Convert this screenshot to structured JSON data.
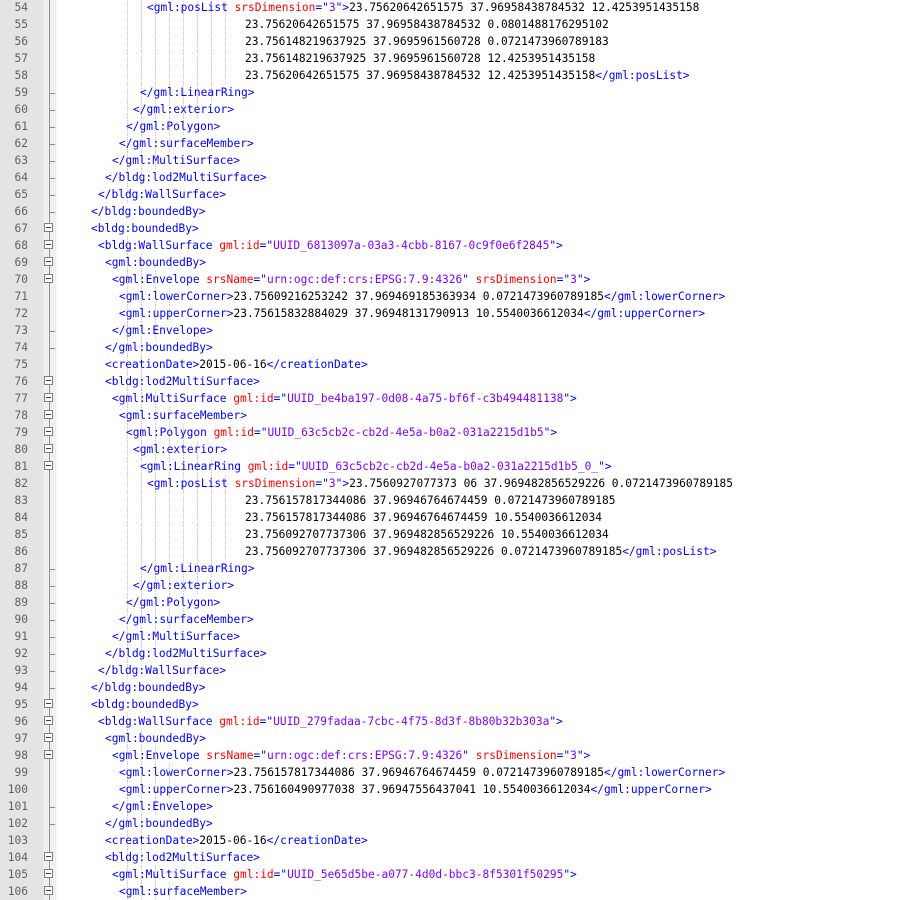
{
  "editor": {
    "lines": [
      {
        "n": "54",
        "indent": 13,
        "fold": "none",
        "segs": [
          [
            "t",
            "<gml:posList "
          ],
          [
            "a",
            "srsDimension"
          ],
          [
            "t",
            "=\""
          ],
          [
            "v",
            "3"
          ],
          [
            "t",
            "\">"
          ],
          [
            "x",
            "23.75620642651575 37.96958438784532 12.4253951435158"
          ]
        ]
      },
      {
        "n": "55",
        "indent": 27,
        "fold": "none",
        "segs": [
          [
            "x",
            "23.75620642651575 37.96958438784532 0.0801488176295102"
          ]
        ]
      },
      {
        "n": "56",
        "indent": 27,
        "fold": "none",
        "segs": [
          [
            "x",
            "23.756148219637925 37.9695961560728 0.0721473960789183"
          ]
        ]
      },
      {
        "n": "57",
        "indent": 27,
        "fold": "none",
        "segs": [
          [
            "x",
            "23.756148219637925 37.9695961560728 12.4253951435158"
          ]
        ]
      },
      {
        "n": "58",
        "indent": 27,
        "fold": "none",
        "segs": [
          [
            "x",
            "23.75620642651575 37.96958438784532 12.4253951435158"
          ],
          [
            "t",
            "</gml:posList>"
          ]
        ]
      },
      {
        "n": "59",
        "indent": 12,
        "fold": "end",
        "segs": [
          [
            "t",
            "</gml:LinearRing>"
          ]
        ]
      },
      {
        "n": "60",
        "indent": 11,
        "fold": "end",
        "segs": [
          [
            "t",
            "</gml:exterior>"
          ]
        ]
      },
      {
        "n": "61",
        "indent": 10,
        "fold": "end",
        "segs": [
          [
            "t",
            "</gml:Polygon>"
          ]
        ]
      },
      {
        "n": "62",
        "indent": 9,
        "fold": "end",
        "segs": [
          [
            "t",
            "</gml:surfaceMember>"
          ]
        ]
      },
      {
        "n": "63",
        "indent": 8,
        "fold": "end",
        "segs": [
          [
            "t",
            "</gml:MultiSurface>"
          ]
        ]
      },
      {
        "n": "64",
        "indent": 7,
        "fold": "end",
        "segs": [
          [
            "t",
            "</bldg:lod2MultiSurface>"
          ]
        ]
      },
      {
        "n": "65",
        "indent": 6,
        "fold": "end",
        "segs": [
          [
            "t",
            "</bldg:WallSurface>"
          ]
        ]
      },
      {
        "n": "66",
        "indent": 5,
        "fold": "end",
        "segs": [
          [
            "t",
            "</bldg:boundedBy>"
          ]
        ]
      },
      {
        "n": "67",
        "indent": 5,
        "fold": "open",
        "segs": [
          [
            "t",
            "<bldg:boundedBy>"
          ]
        ]
      },
      {
        "n": "68",
        "indent": 6,
        "fold": "open",
        "segs": [
          [
            "t",
            "<bldg:WallSurface "
          ],
          [
            "a",
            "gml:id"
          ],
          [
            "t",
            "=\""
          ],
          [
            "v",
            "UUID_6813097a-03a3-4cbb-8167-0c9f0e6f2845"
          ],
          [
            "t",
            "\">"
          ]
        ]
      },
      {
        "n": "69",
        "indent": 7,
        "fold": "open",
        "segs": [
          [
            "t",
            "<gml:boundedBy>"
          ]
        ]
      },
      {
        "n": "70",
        "indent": 8,
        "fold": "open",
        "segs": [
          [
            "t",
            "<gml:Envelope "
          ],
          [
            "a",
            "srsName"
          ],
          [
            "t",
            "=\""
          ],
          [
            "v",
            "urn:ogc:def:crs:EPSG:7.9:4326"
          ],
          [
            "t",
            "\" "
          ],
          [
            "a",
            "srsDimension"
          ],
          [
            "t",
            "=\""
          ],
          [
            "v",
            "3"
          ],
          [
            "t",
            "\">"
          ]
        ]
      },
      {
        "n": "71",
        "indent": 9,
        "fold": "none",
        "segs": [
          [
            "t",
            "<gml:lowerCorner>"
          ],
          [
            "x",
            "23.75609216253242 37.969469185363934 0.0721473960789185"
          ],
          [
            "t",
            "</gml:lowerCorner>"
          ]
        ]
      },
      {
        "n": "72",
        "indent": 9,
        "fold": "none",
        "segs": [
          [
            "t",
            "<gml:upperCorner>"
          ],
          [
            "x",
            "23.75615832884029 37.96948131790913 10.5540036612034"
          ],
          [
            "t",
            "</gml:upperCorner>"
          ]
        ]
      },
      {
        "n": "73",
        "indent": 8,
        "fold": "end",
        "segs": [
          [
            "t",
            "</gml:Envelope>"
          ]
        ]
      },
      {
        "n": "74",
        "indent": 7,
        "fold": "end",
        "segs": [
          [
            "t",
            "</gml:boundedBy>"
          ]
        ]
      },
      {
        "n": "75",
        "indent": 7,
        "fold": "none",
        "segs": [
          [
            "t",
            "<creationDate>"
          ],
          [
            "x",
            "2015-06-16"
          ],
          [
            "t",
            "</creationDate>"
          ]
        ]
      },
      {
        "n": "76",
        "indent": 7,
        "fold": "open",
        "segs": [
          [
            "t",
            "<bldg:lod2MultiSurface>"
          ]
        ]
      },
      {
        "n": "77",
        "indent": 8,
        "fold": "open",
        "segs": [
          [
            "t",
            "<gml:MultiSurface "
          ],
          [
            "a",
            "gml:id"
          ],
          [
            "t",
            "=\""
          ],
          [
            "v",
            "UUID_be4ba197-0d08-4a75-bf6f-c3b494481138"
          ],
          [
            "t",
            "\">"
          ]
        ]
      },
      {
        "n": "78",
        "indent": 9,
        "fold": "open",
        "segs": [
          [
            "t",
            "<gml:surfaceMember>"
          ]
        ]
      },
      {
        "n": "79",
        "indent": 10,
        "fold": "open",
        "segs": [
          [
            "t",
            "<gml:Polygon "
          ],
          [
            "a",
            "gml:id"
          ],
          [
            "t",
            "=\""
          ],
          [
            "v",
            "UUID_63c5cb2c-cb2d-4e5a-b0a2-031a2215d1b5"
          ],
          [
            "t",
            "\">"
          ]
        ]
      },
      {
        "n": "80",
        "indent": 11,
        "fold": "open",
        "segs": [
          [
            "t",
            "<gml:exterior>"
          ]
        ]
      },
      {
        "n": "81",
        "indent": 12,
        "fold": "open",
        "segs": [
          [
            "t",
            "<gml:LinearRing "
          ],
          [
            "a",
            "gml:id"
          ],
          [
            "t",
            "=\""
          ],
          [
            "v",
            "UUID_63c5cb2c-cb2d-4e5a-b0a2-031a2215d1b5_0_"
          ],
          [
            "t",
            "\">"
          ]
        ]
      },
      {
        "n": "82",
        "indent": 13,
        "fold": "none",
        "segs": [
          [
            "t",
            "<gml:posList "
          ],
          [
            "a",
            "srsDimension"
          ],
          [
            "t",
            "=\""
          ],
          [
            "v",
            "3"
          ],
          [
            "t",
            "\">"
          ],
          [
            "x",
            "23.7560927077373 06 37.969482856529226 0.0721473960789185"
          ]
        ]
      },
      {
        "n": "83",
        "indent": 27,
        "fold": "none",
        "segs": [
          [
            "x",
            "23.756157817344086 37.96946764674459 0.0721473960789185"
          ]
        ]
      },
      {
        "n": "84",
        "indent": 27,
        "fold": "none",
        "segs": [
          [
            "x",
            "23.756157817344086 37.96946764674459 10.5540036612034"
          ]
        ]
      },
      {
        "n": "85",
        "indent": 27,
        "fold": "none",
        "segs": [
          [
            "x",
            "23.756092707737306 37.969482856529226 10.5540036612034"
          ]
        ]
      },
      {
        "n": "86",
        "indent": 27,
        "fold": "none",
        "segs": [
          [
            "x",
            "23.756092707737306 37.969482856529226 0.0721473960789185"
          ],
          [
            "t",
            "</gml:posList>"
          ]
        ]
      },
      {
        "n": "87",
        "indent": 12,
        "fold": "end",
        "segs": [
          [
            "t",
            "</gml:LinearRing>"
          ]
        ]
      },
      {
        "n": "88",
        "indent": 11,
        "fold": "end",
        "segs": [
          [
            "t",
            "</gml:exterior>"
          ]
        ]
      },
      {
        "n": "89",
        "indent": 10,
        "fold": "end",
        "segs": [
          [
            "t",
            "</gml:Polygon>"
          ]
        ]
      },
      {
        "n": "90",
        "indent": 9,
        "fold": "end",
        "segs": [
          [
            "t",
            "</gml:surfaceMember>"
          ]
        ]
      },
      {
        "n": "91",
        "indent": 8,
        "fold": "end",
        "segs": [
          [
            "t",
            "</gml:MultiSurface>"
          ]
        ]
      },
      {
        "n": "92",
        "indent": 7,
        "fold": "end",
        "segs": [
          [
            "t",
            "</bldg:lod2MultiSurface>"
          ]
        ]
      },
      {
        "n": "93",
        "indent": 6,
        "fold": "end",
        "segs": [
          [
            "t",
            "</bldg:WallSurface>"
          ]
        ]
      },
      {
        "n": "94",
        "indent": 5,
        "fold": "end",
        "segs": [
          [
            "t",
            "</bldg:boundedBy>"
          ]
        ]
      },
      {
        "n": "95",
        "indent": 5,
        "fold": "open",
        "segs": [
          [
            "t",
            "<bldg:boundedBy>"
          ]
        ]
      },
      {
        "n": "96",
        "indent": 6,
        "fold": "open",
        "segs": [
          [
            "t",
            "<bldg:WallSurface "
          ],
          [
            "a",
            "gml:id"
          ],
          [
            "t",
            "=\""
          ],
          [
            "v",
            "UUID_279fadaa-7cbc-4f75-8d3f-8b80b32b303a"
          ],
          [
            "t",
            "\">"
          ]
        ]
      },
      {
        "n": "97",
        "indent": 7,
        "fold": "open",
        "segs": [
          [
            "t",
            "<gml:boundedBy>"
          ]
        ]
      },
      {
        "n": "98",
        "indent": 8,
        "fold": "open",
        "segs": [
          [
            "t",
            "<gml:Envelope "
          ],
          [
            "a",
            "srsName"
          ],
          [
            "t",
            "=\""
          ],
          [
            "v",
            "urn:ogc:def:crs:EPSG:7.9:4326"
          ],
          [
            "t",
            "\" "
          ],
          [
            "a",
            "srsDimension"
          ],
          [
            "t",
            "=\""
          ],
          [
            "v",
            "3"
          ],
          [
            "t",
            "\">"
          ]
        ]
      },
      {
        "n": "99",
        "indent": 9,
        "fold": "none",
        "segs": [
          [
            "t",
            "<gml:lowerCorner>"
          ],
          [
            "x",
            "23.756157817344086 37.96946764674459 0.0721473960789185"
          ],
          [
            "t",
            "</gml:lowerCorner>"
          ]
        ]
      },
      {
        "n": "100",
        "indent": 9,
        "fold": "none",
        "segs": [
          [
            "t",
            "<gml:upperCorner>"
          ],
          [
            "x",
            "23.756160490977038 37.96947556437041 10.5540036612034"
          ],
          [
            "t",
            "</gml:upperCorner>"
          ]
        ]
      },
      {
        "n": "101",
        "indent": 8,
        "fold": "end",
        "segs": [
          [
            "t",
            "</gml:Envelope>"
          ]
        ]
      },
      {
        "n": "102",
        "indent": 7,
        "fold": "end",
        "segs": [
          [
            "t",
            "</gml:boundedBy>"
          ]
        ]
      },
      {
        "n": "103",
        "indent": 7,
        "fold": "none",
        "segs": [
          [
            "t",
            "<creationDate>"
          ],
          [
            "x",
            "2015-06-16"
          ],
          [
            "t",
            "</creationDate>"
          ]
        ]
      },
      {
        "n": "104",
        "indent": 7,
        "fold": "open",
        "segs": [
          [
            "t",
            "<bldg:lod2MultiSurface>"
          ]
        ]
      },
      {
        "n": "105",
        "indent": 8,
        "fold": "open",
        "segs": [
          [
            "t",
            "<gml:MultiSurface "
          ],
          [
            "a",
            "gml:id"
          ],
          [
            "t",
            "=\""
          ],
          [
            "v",
            "UUID_5e65d5be-a077-4d0d-bbc3-8f5301f50295"
          ],
          [
            "t",
            "\">"
          ]
        ]
      },
      {
        "n": "106",
        "indent": 9,
        "fold": "open",
        "segs": [
          [
            "t",
            "<gml:surfaceMember>"
          ]
        ]
      }
    ]
  }
}
